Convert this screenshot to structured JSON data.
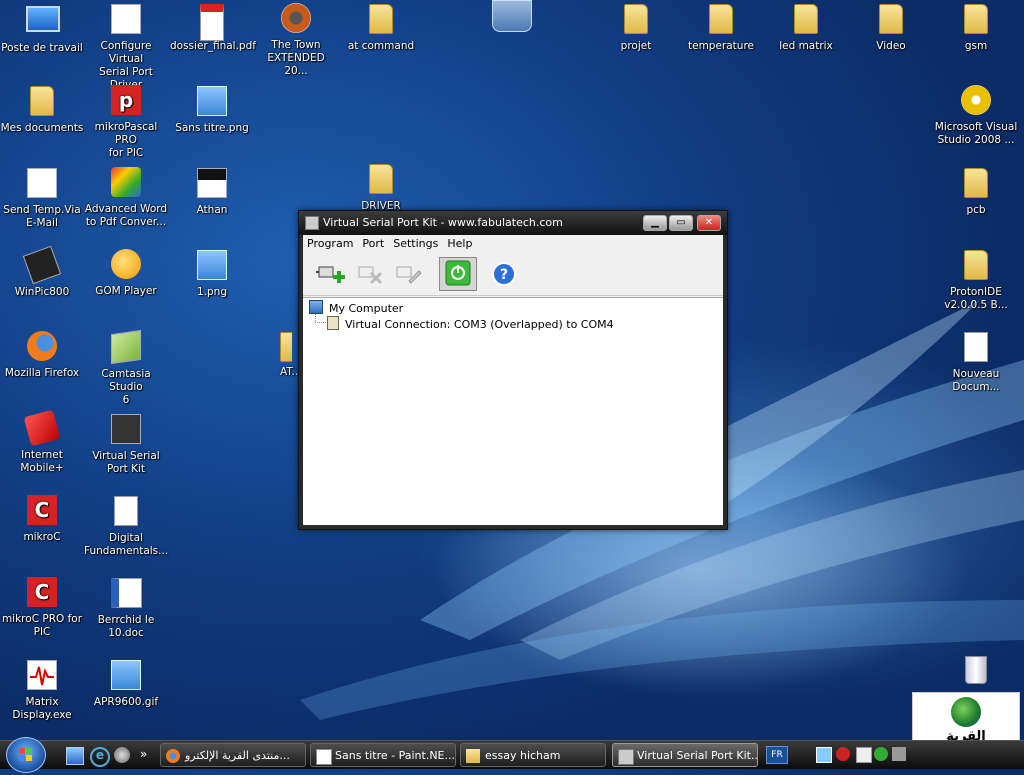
{
  "desktop": {
    "icons": [
      {
        "label": "Poste de travail",
        "kind": "monitor"
      },
      {
        "label": "Configure Virtual\nSerial Port Driver",
        "kind": "app"
      },
      {
        "label": "dossier_final.pdf",
        "kind": "pdf"
      },
      {
        "label": "The Town\nEXTENDED 20...",
        "kind": "rm"
      },
      {
        "label": "at command",
        "kind": "folder"
      },
      {
        "label": "projet",
        "kind": "folder"
      },
      {
        "label": "temperature",
        "kind": "folder"
      },
      {
        "label": "led matrix",
        "kind": "folder"
      },
      {
        "label": "Video",
        "kind": "folder"
      },
      {
        "label": "gsm",
        "kind": "folder"
      },
      {
        "label": "Mes documents",
        "kind": "folder"
      },
      {
        "label": "mikroPascal PRO\nfor PIC",
        "kind": "mikro-p"
      },
      {
        "label": "Sans titre.png",
        "kind": "image"
      },
      {
        "label": "Microsoft Visual\nStudio 2008 ...",
        "kind": "cd"
      },
      {
        "label": "Send Temp.Via\nE-Mail",
        "kind": "app"
      },
      {
        "label": "Advanced Word\nto Pdf Conver...",
        "kind": "app"
      },
      {
        "label": "Athan",
        "kind": "app"
      },
      {
        "label": "DRIVER",
        "kind": "folder"
      },
      {
        "label": "pcb",
        "kind": "folder"
      },
      {
        "label": "WinPic800",
        "kind": "app"
      },
      {
        "label": "GOM Player",
        "kind": "app"
      },
      {
        "label": "1.png",
        "kind": "image"
      },
      {
        "label": "ProtonIDE\nv2.0.0.5 B...",
        "kind": "folder"
      },
      {
        "label": "Mozilla Firefox",
        "kind": "firefox"
      },
      {
        "label": "Camtasia Studio\n6",
        "kind": "app"
      },
      {
        "label": "AT...",
        "kind": "folder"
      },
      {
        "label": "Nouveau\nDocum...",
        "kind": "doc"
      },
      {
        "label": "Internet Mobile+",
        "kind": "app"
      },
      {
        "label": "Virtual Serial\nPort Kit",
        "kind": "app"
      },
      {
        "label": "mikroC",
        "kind": "mikro-c"
      },
      {
        "label": "Digital\nFundamentals...",
        "kind": "doc"
      },
      {
        "label": "mikroC PRO for\nPIC",
        "kind": "mikro-c"
      },
      {
        "label": "Berrchid le\n10.doc",
        "kind": "word"
      },
      {
        "label": "Matrix\nDisplay.exe",
        "kind": "app"
      },
      {
        "label": "APR9600.gif",
        "kind": "image"
      },
      {
        "label": "",
        "kind": "recycle-bin"
      }
    ]
  },
  "window": {
    "title": "Virtual Serial Port Kit - www.fabulatech.com",
    "menu": [
      "Program",
      "Port",
      "Settings",
      "Help"
    ],
    "toolbar": [
      "add-connection",
      "remove-connection",
      "edit-connection",
      "power",
      "help"
    ],
    "tree": {
      "root": "My Computer",
      "child": "Virtual Connection: COM3 (Overlapped) to COM4"
    }
  },
  "taskbar": {
    "tasks": [
      {
        "label": "منتدى القرية الإلكترو..."
      },
      {
        "label": "Sans titre - Paint.NE..."
      },
      {
        "label": "essay hicham"
      },
      {
        "label": "Virtual Serial Port Kit..."
      }
    ],
    "language": "FR"
  },
  "watermark": {
    "text": "القرية الالكترونية"
  }
}
